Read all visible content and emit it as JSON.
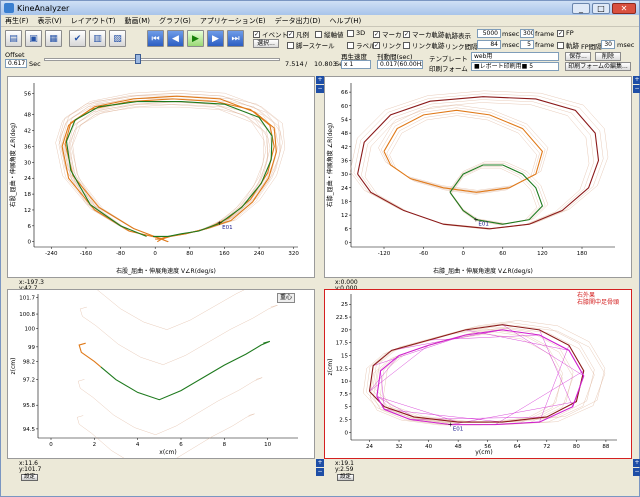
{
  "window": {
    "title": "KineAnalyzer",
    "btn_min": "_",
    "btn_max": "□",
    "btn_close": "✕"
  },
  "menu": [
    "再生(F)",
    "表示(V)",
    "レイアウト(T)",
    "動画(M)",
    "グラフ(G)",
    "アプリケーション(E)",
    "データ出力(D)",
    "ヘルプ(H)"
  ],
  "toolbar": {
    "offset_label": "Offset",
    "offset_value": "0.617",
    "offset_unit": "Sec",
    "time_current": "7.514",
    "time_sep": "/",
    "time_total": "10.803",
    "time_unit": "Sec",
    "select_button": "選択...",
    "checks": [
      {
        "label": "イベント",
        "checked": true
      },
      {
        "label": "凡例",
        "checked": true
      },
      {
        "label": "縦軸値",
        "checked": false
      },
      {
        "label": "脚ースケール",
        "checked": false
      },
      {
        "label": "3D",
        "checked": false
      },
      {
        "label": "ラベル",
        "checked": false
      },
      {
        "label": "マーカ",
        "checked": true
      },
      {
        "label": "リンク",
        "checked": true
      },
      {
        "label": "マーカ軌跡",
        "checked": true
      },
      {
        "label": "リンク軌跡",
        "checked": false
      }
    ],
    "play_speed_label": "再生速度",
    "play_speed_value": "x 1",
    "interval_label": "刊動間(sec)",
    "interval_value": "0.017(60.00Hz)",
    "trace_label": "軌跡表示",
    "trace_msec": "5000",
    "trace_msec_unit": "msec",
    "trace_frames": "300",
    "trace_frames_unit": "frame",
    "link_label": "リンク間隔",
    "link_msec": "84",
    "link_msec_unit": "msec",
    "link_frames": "5",
    "link_frames_unit": "frame",
    "fp_label": "FP",
    "fp_checked": true,
    "trace_fp_label": "軌跡",
    "fp_interval_label": "FP間隔",
    "fp_interval_value": "30",
    "fp_interval_unit": "msec",
    "template_label": "テンプレート",
    "template_value": "web用",
    "print_label": "印刷フォーム",
    "print_value": "■レポート印刷用■ 5",
    "save_button": "保存...",
    "delete_button": "削除",
    "print_edit_button": "印刷フォームの編集..."
  },
  "panels": [
    {
      "id": "tl",
      "ylabel": "右股_屈曲・伸展角度 ∠R(deg)",
      "xlabel": "右股_屈曲・伸展角速度 V∠R(deg/s)",
      "readout_x": "x:-197.3",
      "readout_y": "y:42.7",
      "set_button": "設定",
      "event_label": "E01"
    },
    {
      "id": "tr",
      "ylabel": "右膝_屈曲・伸展角度 ∠R(deg)",
      "xlabel": "右膝_屈曲・伸展角速度 V∠R(deg/s)",
      "readout_x": "x:0.000",
      "readout_y": "y:0.000",
      "set_button": "設定",
      "event_label": "E01"
    },
    {
      "id": "bl",
      "ylabel": "z(cm)",
      "xlabel": "x(cm)",
      "readout_x": "x:11.6",
      "readout_y": "y:101.7",
      "set_button": "設定",
      "zoom_tag": "重心"
    },
    {
      "id": "br",
      "ylabel": "z(cm)",
      "xlabel": "y(cm)",
      "readout_x": "x:19.1",
      "readout_y": "y:2.59",
      "set_button": "設定",
      "legend": [
        "右外果",
        "右膝関中足骨頭"
      ],
      "event_label": "E01"
    }
  ],
  "colors": {
    "orange": "#e07a1a",
    "green": "#1e7a1e",
    "darkred": "#8b1a1a",
    "magenta": "#d020d0",
    "tan": "#d9a88a",
    "blue_btn": "#1e4ea6"
  },
  "chart_data": [
    {
      "id": "tl",
      "type": "line",
      "xlabel": "右股_屈曲・伸展角速度 V∠R(deg/s)",
      "ylabel": "右股_屈曲・伸展角度 ∠R(deg)",
      "xticks": [
        -240,
        -160,
        -80,
        0,
        80,
        160,
        240,
        320
      ],
      "yticks": [
        0,
        6,
        12,
        18,
        24,
        30,
        36,
        42,
        48,
        56
      ],
      "xlim": [
        -280,
        330
      ],
      "ylim": [
        -2,
        60
      ],
      "series": [
        {
          "color": "orange",
          "x": [
            20,
            -60,
            -140,
            -200,
            -215,
            -200,
            -150,
            -60,
            40,
            140,
            220,
            265,
            275,
            260,
            220,
            170,
            120,
            70,
            30,
            10,
            0
          ],
          "y": [
            1,
            4,
            12,
            24,
            36,
            44,
            50,
            53,
            54,
            53,
            50,
            44,
            36,
            26,
            16,
            9,
            5,
            3,
            2,
            1,
            1
          ]
        },
        {
          "color": "orange",
          "x": [
            30,
            -50,
            -130,
            -190,
            -208,
            -195,
            -140,
            -50,
            50,
            150,
            230,
            275,
            280,
            262,
            225,
            175,
            120,
            70,
            35,
            15,
            5
          ],
          "y": [
            0,
            5,
            13,
            25,
            37,
            45,
            51,
            54,
            55,
            54,
            49,
            43,
            34,
            24,
            15,
            8,
            5,
            3,
            2,
            1,
            0
          ]
        },
        {
          "color": "green",
          "x": [
            -20,
            -80,
            -150,
            -195,
            -205,
            -185,
            -130,
            -40,
            60,
            160,
            240,
            270,
            268,
            245,
            200,
            150,
            100,
            60,
            30,
            10,
            -5
          ],
          "y": [
            2,
            6,
            14,
            27,
            38,
            46,
            51,
            53,
            53,
            52,
            47,
            40,
            31,
            22,
            13,
            7,
            4,
            3,
            2,
            2,
            2
          ]
        }
      ]
    },
    {
      "id": "tr",
      "type": "line",
      "xlabel": "右膝_屈曲・伸展角速度 V∠R(deg/s)",
      "ylabel": "右膝_屈曲・伸展角度 ∠R(deg)",
      "xticks": [
        -120,
        -60,
        0,
        60,
        120,
        180
      ],
      "yticks": [
        0,
        6,
        12,
        18,
        24,
        30,
        36,
        42,
        48,
        54,
        60,
        66
      ],
      "xlim": [
        -170,
        230
      ],
      "ylim": [
        -2,
        70
      ],
      "series": [
        {
          "color": "darkred",
          "x": [
            -160,
            -150,
            -110,
            -50,
            30,
            110,
            170,
            200,
            205,
            190,
            150,
            100,
            40,
            -30,
            -90,
            -140,
            -160
          ],
          "y": [
            30,
            44,
            56,
            62,
            64,
            63,
            58,
            48,
            36,
            24,
            14,
            8,
            6,
            8,
            14,
            22,
            30
          ]
        },
        {
          "color": "orange",
          "x": [
            -120,
            -100,
            -60,
            -10,
            40,
            90,
            120,
            110,
            70,
            20,
            -30,
            -80,
            -110,
            -120
          ],
          "y": [
            40,
            50,
            56,
            58,
            56,
            50,
            40,
            30,
            24,
            22,
            24,
            28,
            34,
            40
          ]
        },
        {
          "color": "green",
          "x": [
            -20,
            0,
            30,
            60,
            90,
            110,
            120,
            100,
            60,
            20,
            0,
            -10,
            -20
          ],
          "y": [
            22,
            30,
            34,
            34,
            30,
            24,
            16,
            10,
            8,
            10,
            14,
            18,
            22
          ]
        }
      ]
    },
    {
      "id": "bl",
      "type": "line",
      "xlabel": "x(cm)",
      "ylabel": "z(cm)",
      "xticks": [
        0,
        2,
        4,
        6,
        8,
        10
      ],
      "yticks": [
        94.5,
        95.8,
        97.2,
        98.2,
        99.0,
        100.0,
        100.8,
        101.7
      ],
      "xlim": [
        -0.6,
        11.4
      ],
      "ylim": [
        94.0,
        101.9
      ],
      "series": [
        {
          "color": "orange",
          "x": [
            2.3,
            2.0,
            1.4,
            1.3,
            1.6
          ],
          "y": [
            97.9,
            98.2,
            98.7,
            99.1,
            99.2
          ]
        },
        {
          "color": "green",
          "x": [
            2.3,
            3.0,
            4.0,
            5.0,
            6.0,
            7.0,
            8.0,
            9.0,
            9.7,
            10.1,
            9.8
          ],
          "y": [
            97.9,
            97.2,
            96.5,
            96.1,
            96.6,
            97.3,
            98.0,
            98.6,
            99.1,
            99.3,
            99.2
          ]
        }
      ]
    },
    {
      "id": "br",
      "type": "line",
      "xlabel": "y(cm)",
      "ylabel": "z(cm)",
      "xticks": [
        24,
        32,
        40,
        48,
        56,
        64,
        72,
        80,
        88
      ],
      "yticks": [
        0,
        2.5,
        5,
        7.5,
        10,
        12.5,
        15,
        17.5,
        20,
        22.5,
        25
      ],
      "xlim": [
        19,
        91
      ],
      "ylim": [
        -1.5,
        27
      ],
      "series": [
        {
          "name": "右外果",
          "color": "darkred",
          "x": [
            24,
            25,
            30,
            40,
            50,
            60,
            70,
            78,
            82,
            80,
            72,
            60,
            48,
            36,
            28,
            24
          ],
          "y": [
            8,
            13,
            16,
            18,
            20,
            21,
            20,
            17,
            12,
            6,
            3,
            2,
            2,
            3,
            5,
            8
          ]
        },
        {
          "name": "右膝関中足骨頭",
          "color": "magenta",
          "x": [
            26,
            27,
            32,
            40,
            50,
            60,
            70,
            78,
            82,
            79,
            70,
            58,
            46,
            35,
            28,
            26
          ],
          "y": [
            7,
            12,
            15,
            17,
            19,
            20,
            19,
            16,
            11,
            5,
            2,
            1.5,
            1.5,
            2.5,
            4.5,
            7
          ]
        }
      ]
    }
  ]
}
